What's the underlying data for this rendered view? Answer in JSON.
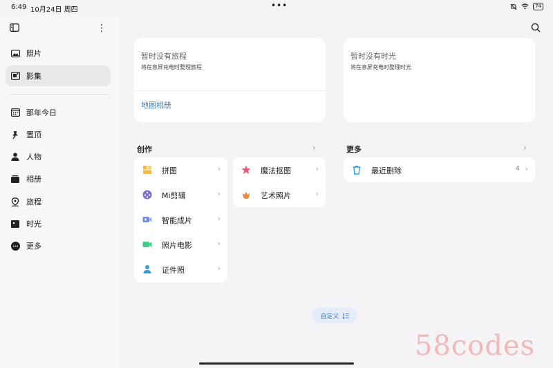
{
  "status": {
    "time": "6:49",
    "date": "10月24日 周四",
    "dots": "•••",
    "battery": "74"
  },
  "sidebar": {
    "items": [
      {
        "label": "照片",
        "icon": "image-icon"
      },
      {
        "label": "影集",
        "icon": "album-icon",
        "active": true
      },
      {
        "label": "那年今日",
        "icon": "calendar-icon"
      },
      {
        "label": "置顶",
        "icon": "pin-icon"
      },
      {
        "label": "人物",
        "icon": "person-icon"
      },
      {
        "label": "相册",
        "icon": "folder-icon"
      },
      {
        "label": "旅程",
        "icon": "location-icon"
      },
      {
        "label": "时光",
        "icon": "film-icon"
      },
      {
        "label": "更多",
        "icon": "more-icon"
      }
    ]
  },
  "cards": [
    {
      "title": "暂时没有旅程",
      "subtitle": "将在息屏充电时整理旅程",
      "link": "地图相册"
    },
    {
      "title": "暂时没有时光",
      "subtitle": "将在息屏充电时整理时光"
    }
  ],
  "creation": {
    "title": "创作",
    "left": [
      {
        "label": "拼图",
        "icon": "collage-icon",
        "color": "#f2b93b"
      },
      {
        "label": "Mi剪辑",
        "icon": "mi-edit-icon",
        "color": "#7b6fd6"
      },
      {
        "label": "智能成片",
        "icon": "smart-video-icon",
        "color": "#6c8ee6"
      },
      {
        "label": "照片电影",
        "icon": "photo-movie-icon",
        "color": "#3fcf86"
      },
      {
        "label": "证件照",
        "icon": "id-photo-icon",
        "color": "#2e9be0"
      }
    ],
    "right": [
      {
        "label": "魔法抠图",
        "icon": "magic-cutout-icon",
        "color": "#ec5b74"
      },
      {
        "label": "艺术照片",
        "icon": "art-photo-icon",
        "color": "#f08a3c"
      }
    ]
  },
  "more": {
    "title": "更多",
    "items": [
      {
        "label": "最近删除",
        "count": "4",
        "icon": "trash-icon",
        "color": "#2e9be0"
      }
    ]
  },
  "custom_button": {
    "label": "自定义"
  },
  "watermark": "58codes"
}
